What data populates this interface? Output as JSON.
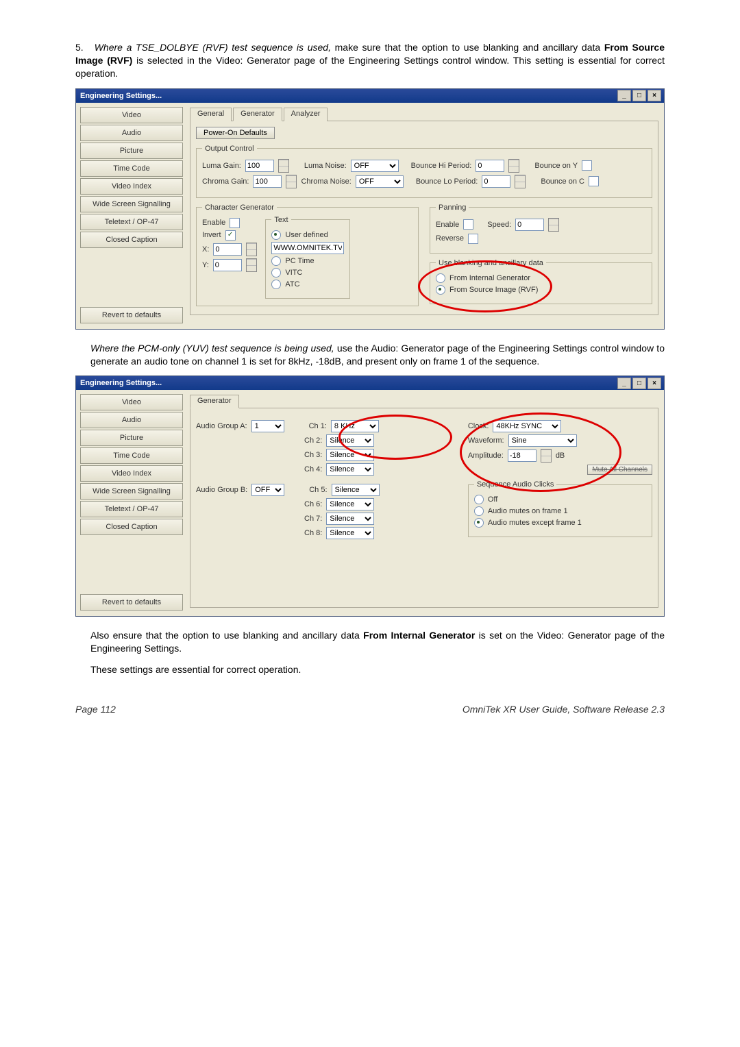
{
  "doc": {
    "step_num": "5.",
    "step5_italic": "Where a TSE_DOLBYE (RVF) test sequence is used,",
    "step5_rest_a": " make sure that the option to use blanking and ancillary data ",
    "step5_bold1": "From Source Image (RVF)",
    "step5_rest_b": " is selected in the Video: Generator page of the Engineering Settings control window. This setting is essential for correct operation.",
    "pcm_italic": "Where the PCM-only (YUV) test sequence is being used,",
    "pcm_rest": " use the Audio: Generator page of the Engineering Settings control window to generate an audio tone on channel 1 is set for 8kHz, -18dB, and present only on frame 1 of the sequence.",
    "also_a": "Also ensure that the option to use blanking and ancillary data ",
    "also_bold": "From Internal Generator",
    "also_b": " is set on the Video: Generator page of the Engineering Settings.",
    "essential": "These settings are essential for correct operation.",
    "page_left": "Page 112",
    "page_right": "OmniTek XR User Guide, Software Release 2.3"
  },
  "win": {
    "title": "Engineering Settings...",
    "nav": [
      "Video",
      "Audio",
      "Picture",
      "Time Code",
      "Video Index",
      "Wide Screen Signalling",
      "Teletext / OP-47",
      "Closed Caption"
    ],
    "revert": "Revert to defaults"
  },
  "vgen": {
    "tabs": [
      "General",
      "Generator",
      "Analyzer"
    ],
    "poweron": "Power-On Defaults",
    "output_control": "Output Control",
    "luma_gain_lbl": "Luma Gain:",
    "luma_gain_val": "100",
    "luma_noise_lbl": "Luma Noise:",
    "luma_noise_val": "OFF",
    "bounce_hi_lbl": "Bounce Hi Period:",
    "bounce_hi_val": "0",
    "bounce_y_lbl": "Bounce on Y",
    "chroma_gain_lbl": "Chroma Gain:",
    "chroma_gain_val": "100",
    "chroma_noise_lbl": "Chroma Noise:",
    "chroma_noise_val": "OFF",
    "bounce_lo_lbl": "Bounce Lo Period:",
    "bounce_lo_val": "0",
    "bounce_c_lbl": "Bounce on C",
    "chargen": "Character Generator",
    "enable": "Enable",
    "invert": "Invert",
    "x_lbl": "X:",
    "x_val": "0",
    "y_lbl": "Y:",
    "y_val": "0",
    "text_group": "Text",
    "userdef": "User defined",
    "userdef_val": "WWW.OMNITEK.TV",
    "pctime": "PC Time",
    "vitc": "VITC",
    "atc": "ATC",
    "panning": "Panning",
    "speed_lbl": "Speed:",
    "speed_val": "0",
    "reverse": "Reverse",
    "blank_group": "Use blanking and ancillary data",
    "from_internal": "From Internal Generator",
    "from_source": "From Source Image (RVF)"
  },
  "agen": {
    "tab": "Generator",
    "groupA_lbl": "Audio Group A:",
    "groupA_val": "1",
    "groupB_lbl": "Audio Group B:",
    "groupB_val": "OFF",
    "ch1": "Ch 1:",
    "ch1_val": "8 KHz",
    "ch2": "Ch 2:",
    "ch2_val": "Silence",
    "ch3": "Ch 3:",
    "ch3_val": "Silence",
    "ch4": "Ch 4:",
    "ch4_val": "Silence",
    "ch5": "Ch 5:",
    "ch5_val": "Silence",
    "ch6": "Ch 6:",
    "ch6_val": "Silence",
    "ch7": "Ch 7:",
    "ch7_val": "Silence",
    "ch8": "Ch 8:",
    "ch8_val": "Silence",
    "clock_lbl": "Clock:",
    "clock_val": "48KHz SYNC",
    "waveform_lbl": "Waveform:",
    "waveform_val": "Sine",
    "amp_lbl": "Amplitude:",
    "amp_val": "-18",
    "amp_unit": "dB",
    "mute": "Mute All Channels",
    "seq_group": "Sequence Audio Clicks",
    "seq_off": "Off",
    "seq_opt1": "Audio mutes on frame 1",
    "seq_opt2": "Audio mutes except frame 1"
  }
}
